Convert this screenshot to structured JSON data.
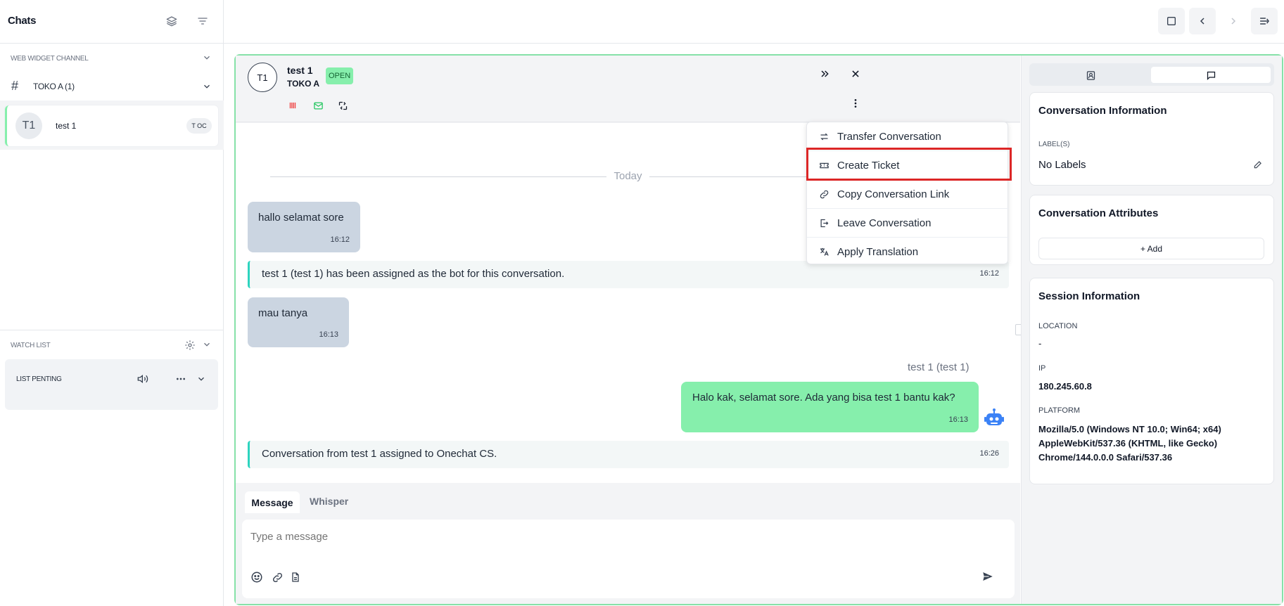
{
  "sidebar": {
    "title": "Chats",
    "channel_section": "WEB WIDGET CHANNEL",
    "channel": {
      "name": "TOKO A (1)"
    },
    "chat": {
      "avatar": "T1",
      "name": "test 1",
      "badge": "T OC"
    },
    "watch_section": "WATCH LIST",
    "watch_item": "LIST PENTING"
  },
  "conversation": {
    "avatar": "T1",
    "name": "test 1",
    "inbox": "TOKO A",
    "status": "OPEN",
    "date_divider": "Today",
    "messages": [
      {
        "kind": "incoming",
        "text": "hallo selamat sore",
        "time": "16:12"
      },
      {
        "kind": "system",
        "text": "test 1 (test 1) has been assigned as the bot for this conversation.",
        "time": "16:12"
      },
      {
        "kind": "incoming",
        "text": "mau tanya",
        "time": "16:13"
      },
      {
        "kind": "outgoing",
        "sender": "test 1 (test 1)",
        "text": "Halo kak, selamat sore. Ada yang bisa test 1 bantu kak?",
        "time": "16:13"
      },
      {
        "kind": "system",
        "text": "Conversation from test 1 assigned to Onechat CS.",
        "time": "16:26"
      }
    ],
    "menu": [
      {
        "label": "Transfer Conversation",
        "icon": "transfer-icon"
      },
      {
        "label": "Create Ticket",
        "icon": "ticket-icon"
      },
      {
        "label": "Copy Conversation Link",
        "icon": "link-icon"
      },
      {
        "label": "Leave Conversation",
        "icon": "leave-icon"
      },
      {
        "label": "Apply Translation",
        "icon": "translate-icon"
      }
    ],
    "composer": {
      "tab_message": "Message",
      "tab_whisper": "Whisper",
      "placeholder": "Type a message"
    }
  },
  "right_panel": {
    "info": {
      "title": "Conversation Information",
      "labels_caption": "LABEL(S)",
      "labels_value": "No Labels"
    },
    "attributes": {
      "title": "Conversation Attributes",
      "add_label": "+ Add"
    },
    "session": {
      "title": "Session Information",
      "location_caption": "LOCATION",
      "location_value": "-",
      "ip_caption": "IP",
      "ip_value": "180.245.60.8",
      "platform_caption": "PLATFORM",
      "platform_line1": "Mozilla/5.0 (Windows NT 10.0; Win64; x64)",
      "platform_line2": "AppleWebKit/537.36 (KHTML, like Gecko)",
      "platform_line3": "Chrome/144.0.0.0 Safari/537.36"
    }
  },
  "colors": {
    "accent_green": "#86efac",
    "frame_green": "#86e1a8",
    "system_border": "#2dd4bf",
    "highlight_red": "#dc2626",
    "bot_blue": "#3b82f6"
  }
}
